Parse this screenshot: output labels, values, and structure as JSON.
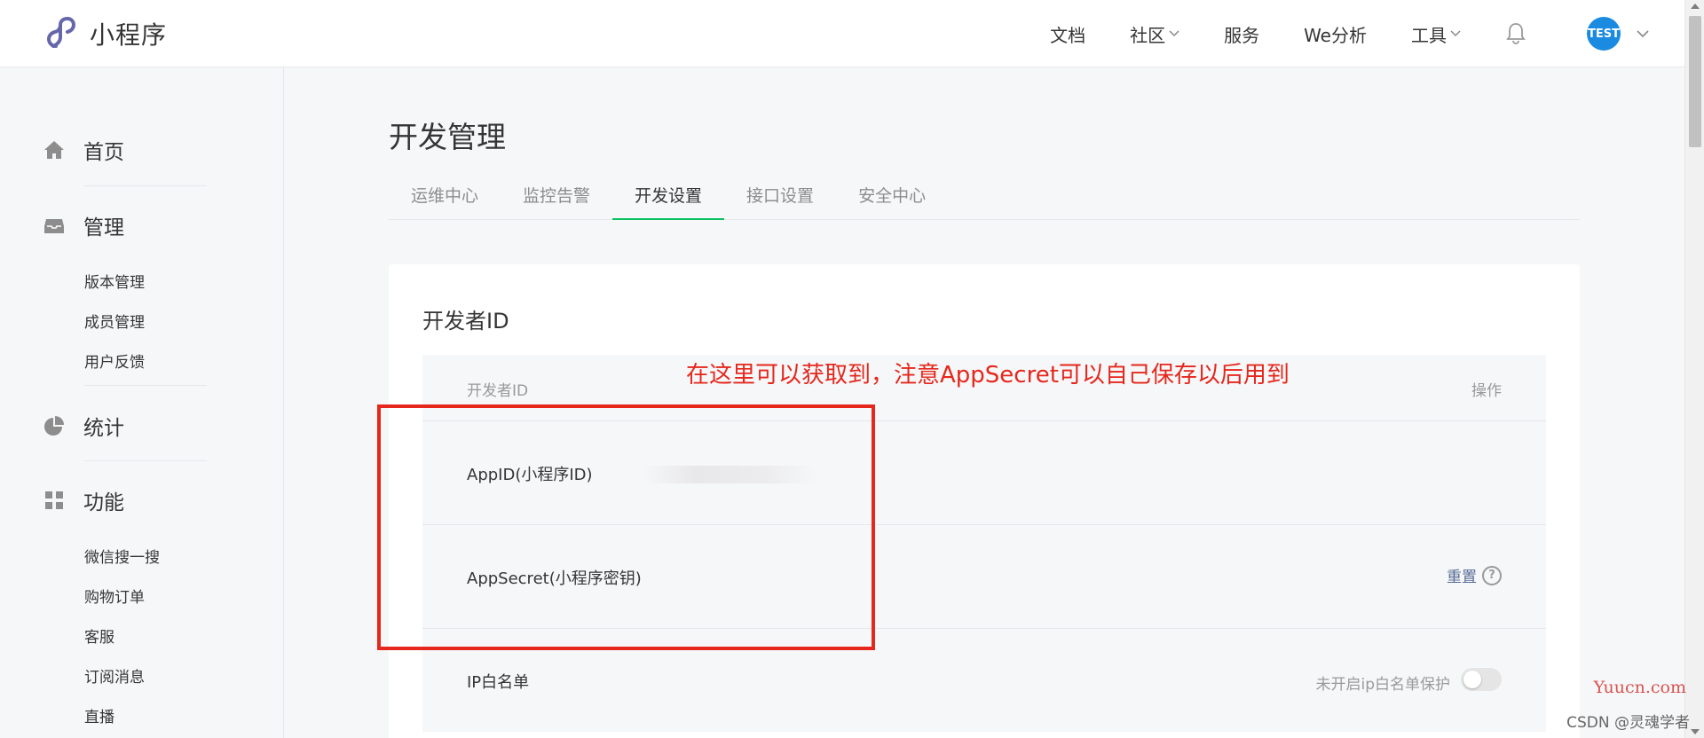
{
  "header": {
    "logo_text": "小程序",
    "nav": [
      {
        "label": "文档",
        "has_dropdown": false
      },
      {
        "label": "社区",
        "has_dropdown": true
      },
      {
        "label": "服务",
        "has_dropdown": false
      },
      {
        "label": "We分析",
        "has_dropdown": false
      },
      {
        "label": "工具",
        "has_dropdown": true
      }
    ],
    "avatar_text": "TEST",
    "brand_color": "#6667ab",
    "avatar_color": "#1a8be0"
  },
  "sidebar": {
    "groups": [
      {
        "label": "首页",
        "icon": "home-icon",
        "items": []
      },
      {
        "label": "管理",
        "icon": "inbox-icon",
        "items": [
          "版本管理",
          "成员管理",
          "用户反馈"
        ]
      },
      {
        "label": "统计",
        "icon": "pie-chart-icon",
        "items": []
      },
      {
        "label": "功能",
        "icon": "grid-icon",
        "items": [
          "微信搜一搜",
          "购物订单",
          "客服",
          "订阅消息",
          "直播"
        ]
      }
    ]
  },
  "main": {
    "title": "开发管理",
    "tabs": [
      {
        "label": "运维中心",
        "active": false
      },
      {
        "label": "监控告警",
        "active": false
      },
      {
        "label": "开发设置",
        "active": true
      },
      {
        "label": "接口设置",
        "active": false
      },
      {
        "label": "安全中心",
        "active": false
      }
    ],
    "card": {
      "title": "开发者ID",
      "table_header": {
        "col1": "开发者ID",
        "col2": "操作"
      },
      "rows": [
        {
          "label": "AppID(小程序ID)"
        },
        {
          "label": "AppSecret(小程序密钥)",
          "action": "重置",
          "help": "?"
        },
        {
          "label": "IP白名单",
          "status": "未开启ip白名单保护",
          "toggle_on": false
        }
      ]
    },
    "active_tab_color": "#07c160",
    "link_color": "#576b95"
  },
  "annotation": {
    "text": "在这里可以获取到，注意AppSecret可以自己保存以后用到",
    "color": "#e5271c"
  },
  "watermarks": {
    "site": "Yuucn.com",
    "csdn": "CSDN @灵魂学者"
  }
}
